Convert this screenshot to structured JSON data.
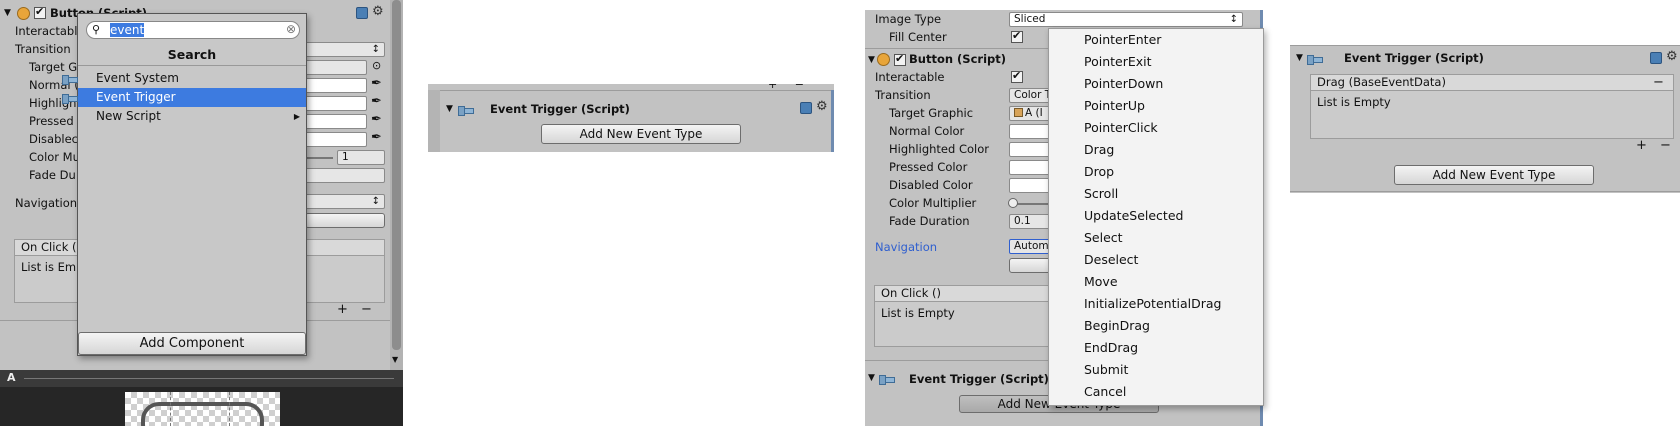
{
  "panel1": {
    "component_title": "Button (Script)",
    "labels": {
      "interactable": "Interactabl",
      "transition": "Transition",
      "target_graphic": "Target G",
      "normal": "Normal (",
      "highlighted": "Highligh",
      "pressed": "Pressed",
      "disabled": "Disablec",
      "color_multiplier": "Color Mu",
      "fade_duration": "Fade Du",
      "navigation": "Navigation"
    },
    "color_multiplier_value": "1",
    "on_click_header": "On Click (",
    "list_empty": "List is Emp",
    "plus": "+",
    "minus": "−",
    "bottom_toolbar_label": "A",
    "search_popup": {
      "query": "event",
      "title": "Search",
      "items": [
        "Event System",
        "Event Trigger",
        "New Script"
      ],
      "add_component_label": "Add Component"
    }
  },
  "panel2": {
    "title": "Event Trigger (Script)",
    "add_event_label": "Add New Event Type",
    "top_buttons": [
      "+",
      "−"
    ]
  },
  "panel3": {
    "image_type_label": "Image Type",
    "image_type_value": "Sliced",
    "fill_center_label": "Fill Center",
    "button_title": "Button (Script)",
    "interactable_label": "Interactable",
    "transition_label": "Transition",
    "transition_value": "Color T",
    "target_graphic_label": "Target Graphic",
    "target_graphic_value": "A (I",
    "normal_color_label": "Normal Color",
    "highlighted_color_label": "Highlighted Color",
    "pressed_color_label": "Pressed Color",
    "disabled_color_label": "Disabled Color",
    "color_multiplier_label": "Color Multiplier",
    "fade_duration_label": "Fade Duration",
    "fade_duration_value": "0.1",
    "navigation_label": "Navigation",
    "navigation_value": "Autom",
    "on_click_header": "On Click ()",
    "list_empty": "List is Empty",
    "event_trigger_title": "Event Trigger (Script)",
    "add_event_label": "Add New Event Type",
    "menu_items": [
      "PointerEnter",
      "PointerExit",
      "PointerDown",
      "PointerUp",
      "PointerClick",
      "Drag",
      "Drop",
      "Scroll",
      "UpdateSelected",
      "Select",
      "Deselect",
      "Move",
      "InitializePotentialDrag",
      "BeginDrag",
      "EndDrag",
      "Submit",
      "Cancel"
    ]
  },
  "panel4": {
    "title": "Event Trigger (Script)",
    "entry_header": "Drag (BaseEventData)",
    "minus": "−",
    "list_empty": "List is Empty",
    "plus": "+",
    "add_event_label": "Add New Event Type"
  },
  "colors": {
    "inspector_bg": "#c2c2c2",
    "selection_blue": "#3d7be0",
    "navigation_link": "#2f5fcf",
    "menu_bg": "#f3f3f3"
  }
}
